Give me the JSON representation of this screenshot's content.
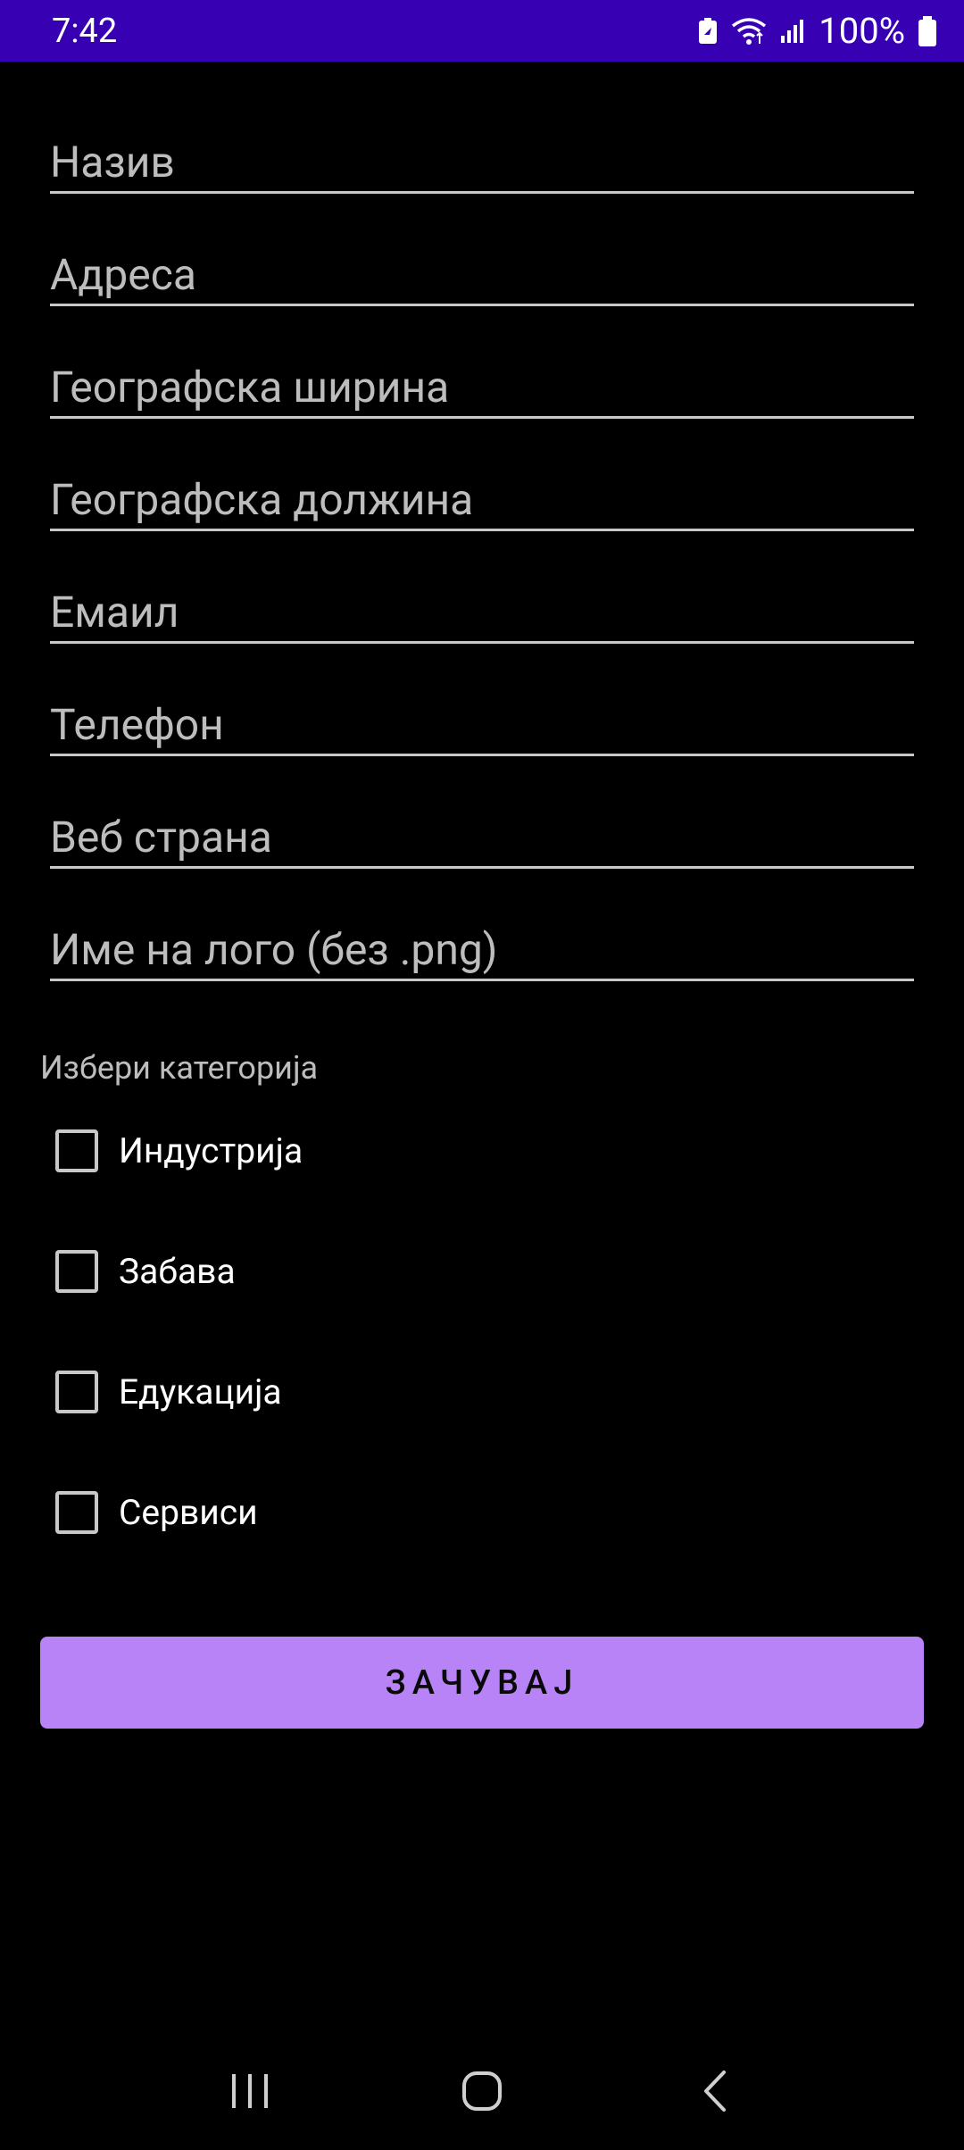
{
  "status_bar": {
    "time": "7:42",
    "battery_percent": "100%",
    "icons": [
      "battery-saver-icon",
      "wifi-icon",
      "signal-icon",
      "battery-icon"
    ]
  },
  "form": {
    "fields": [
      {
        "placeholder": "Назив"
      },
      {
        "placeholder": "Адреса"
      },
      {
        "placeholder": "Географска ширина"
      },
      {
        "placeholder": "Географска должина"
      },
      {
        "placeholder": "Емаил"
      },
      {
        "placeholder": "Телефон"
      },
      {
        "placeholder": "Веб страна"
      },
      {
        "placeholder": "Име на лого (без .png)"
      }
    ],
    "category_label": "Избери категорија",
    "categories": [
      {
        "label": "Индустрија",
        "checked": false
      },
      {
        "label": "Забава",
        "checked": false
      },
      {
        "label": "Едукација",
        "checked": false
      },
      {
        "label": "Сервиси",
        "checked": false
      }
    ],
    "save_label": "ЗАЧУВАЈ"
  },
  "colors": {
    "status_bar": "#3700B3",
    "background": "#000000",
    "button": "#B983F8"
  },
  "nav_bar": {
    "icons": [
      "recent-apps-icon",
      "home-icon",
      "back-icon"
    ]
  }
}
